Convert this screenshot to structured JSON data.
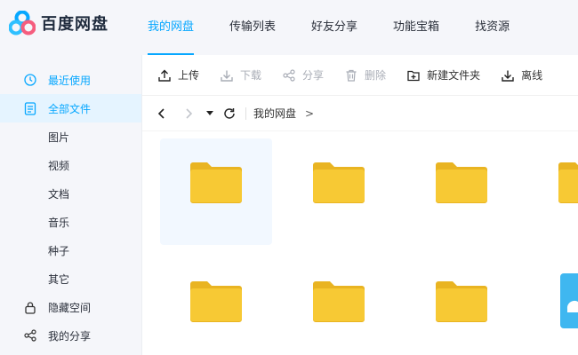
{
  "app": {
    "name": "百度网盘"
  },
  "nav": {
    "items": [
      {
        "label": "我的网盘",
        "active": true
      },
      {
        "label": "传输列表",
        "active": false
      },
      {
        "label": "好友分享",
        "active": false
      },
      {
        "label": "功能宝箱",
        "active": false
      },
      {
        "label": "找资源",
        "active": false
      }
    ]
  },
  "sidebar": {
    "recent": "最近使用",
    "all_files": "全部文件",
    "images": "图片",
    "videos": "视频",
    "docs": "文档",
    "music": "音乐",
    "seeds": "种子",
    "others": "其它",
    "hidden_space": "隐藏空间",
    "my_share": "我的分享"
  },
  "toolbar": {
    "upload": "上传",
    "download": "下载",
    "share": "分享",
    "delete": "删除",
    "new_folder": "新建文件夹",
    "offline": "离线"
  },
  "path": {
    "crumb": "我的网盘",
    "arrow": ">"
  },
  "colors": {
    "accent": "#06a7ff",
    "folder": "#f7c934",
    "folder_tab": "#e9b422"
  },
  "icons": [
    "clock-icon",
    "document-icon",
    "lock-icon",
    "share-icon",
    "upload-icon",
    "download-icon",
    "share-nodes-icon",
    "trash-icon",
    "new-folder-icon",
    "back-icon",
    "forward-icon",
    "dropdown-icon",
    "refresh-icon",
    "folder-icon"
  ]
}
